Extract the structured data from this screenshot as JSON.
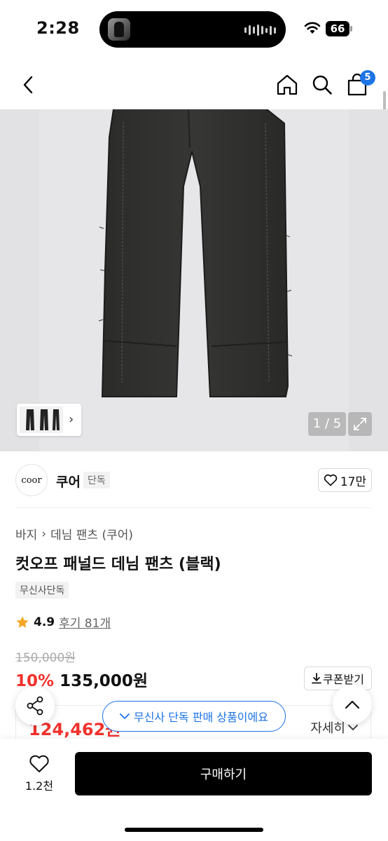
{
  "status_bar": {
    "time": "2:28",
    "battery": "66"
  },
  "nav": {
    "cart_count": "5"
  },
  "gallery": {
    "counter": "1 / 5"
  },
  "brand": {
    "logo_text": "coor",
    "name": "쿠어",
    "tag": "단독",
    "likes": "17만"
  },
  "product": {
    "breadcrumb": [
      "바지",
      "데님 팬츠 (쿠어)"
    ],
    "title": "컷오프 패널드 데님 팬츠 (블랙)",
    "exclusive_chip": "무신사단독",
    "rating": "4.9",
    "reviews": "후기 81개",
    "original_price": "150,000원",
    "discount": "10%",
    "price": "135,000원",
    "coupon_label": "쿠폰받기",
    "best_price": "124,462원",
    "detail_label": "자세히"
  },
  "toast": {
    "text": "무신사 단독 판매 상품이에요"
  },
  "bottom_bar": {
    "wish_count": "1.2천",
    "buy_label": "구매하기"
  },
  "colors": {
    "accent_blue": "#1d74e5",
    "sale_red": "#f0322d",
    "star": "#f5a623"
  }
}
